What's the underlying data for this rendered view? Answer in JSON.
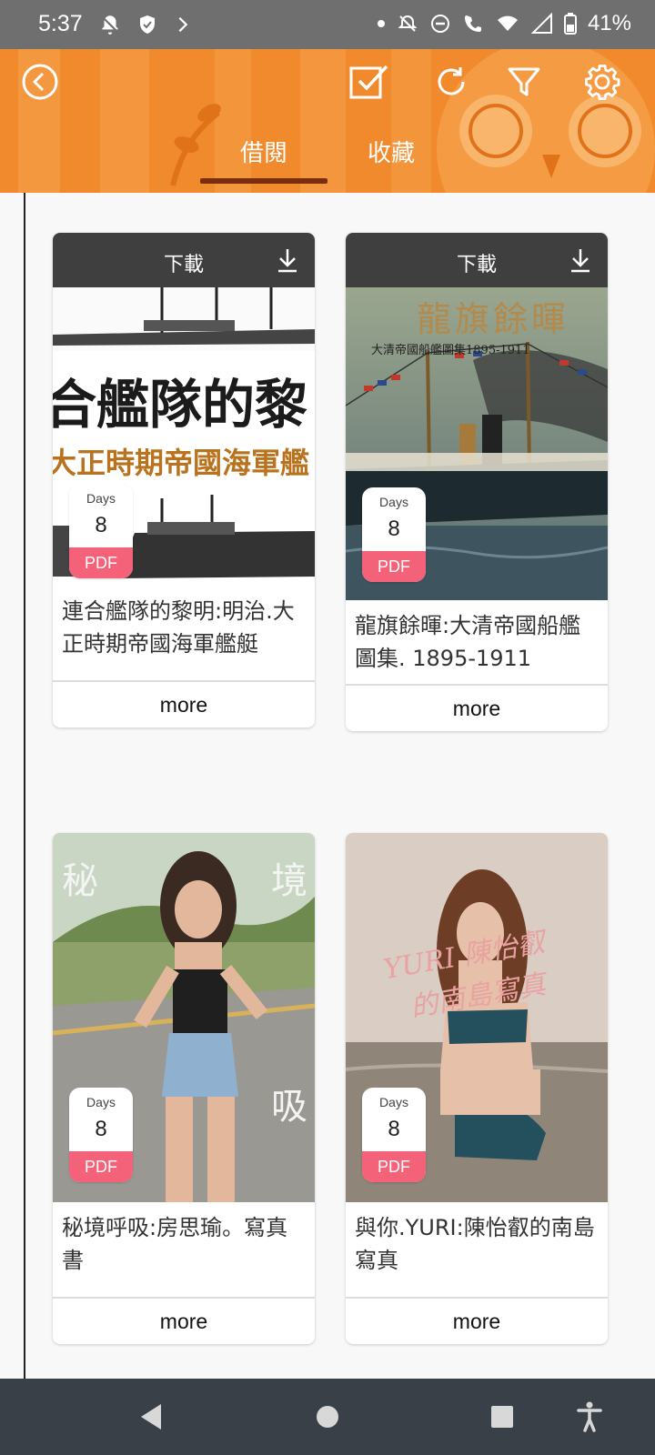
{
  "status_bar": {
    "time": "5:37",
    "battery": "41%",
    "icons_left": [
      "notifications-off-icon",
      "shield-icon",
      "chevron-right-icon"
    ],
    "icons_right": [
      "dot-icon",
      "alarm-off-icon",
      "do-not-disturb-icon",
      "wifi-call-icon",
      "wifi-icon",
      "signal-icon",
      "battery-icon"
    ]
  },
  "header": {
    "back_icon": "back-circle-icon",
    "actions": [
      "checkbox-icon",
      "refresh-icon",
      "filter-icon",
      "settings-icon"
    ],
    "tabs": [
      {
        "label": "借閱",
        "active": true
      },
      {
        "label": "收藏",
        "active": false
      }
    ],
    "accent_color": "#f08a2c"
  },
  "books": [
    {
      "download_label": "下載",
      "days_label": "Days",
      "days": "8",
      "format": "PDF",
      "title": "連合艦隊的黎明:明治.大正時期帝國海軍艦艇",
      "more_label": "more",
      "cover_text": [
        "合艦隊的黎",
        "大正時期帝國海軍艦"
      ]
    },
    {
      "download_label": "下載",
      "days_label": "Days",
      "days": "8",
      "format": "PDF",
      "title": "龍旗餘暉:大清帝國船艦圖集. 1895-1911",
      "more_label": "more",
      "cover_text": [
        "龍旗餘暉",
        "大清帝國船艦圖集1895-1911"
      ]
    },
    {
      "days_label": "Days",
      "days": "8",
      "format": "PDF",
      "title": "秘境呼吸:房思瑜。寫真書",
      "more_label": "more",
      "cover_text": [
        "秘",
        "境",
        "吸"
      ]
    },
    {
      "days_label": "Days",
      "days": "8",
      "format": "PDF",
      "title": "與你.YURI:陳怡叡的南島寫真",
      "more_label": "more",
      "cover_text": [
        "YURI 陳怡叡",
        "的南島寫真"
      ]
    }
  ],
  "nav_bar": [
    "back-triangle-icon",
    "home-circle-icon",
    "recents-square-icon",
    "accessibility-icon"
  ]
}
